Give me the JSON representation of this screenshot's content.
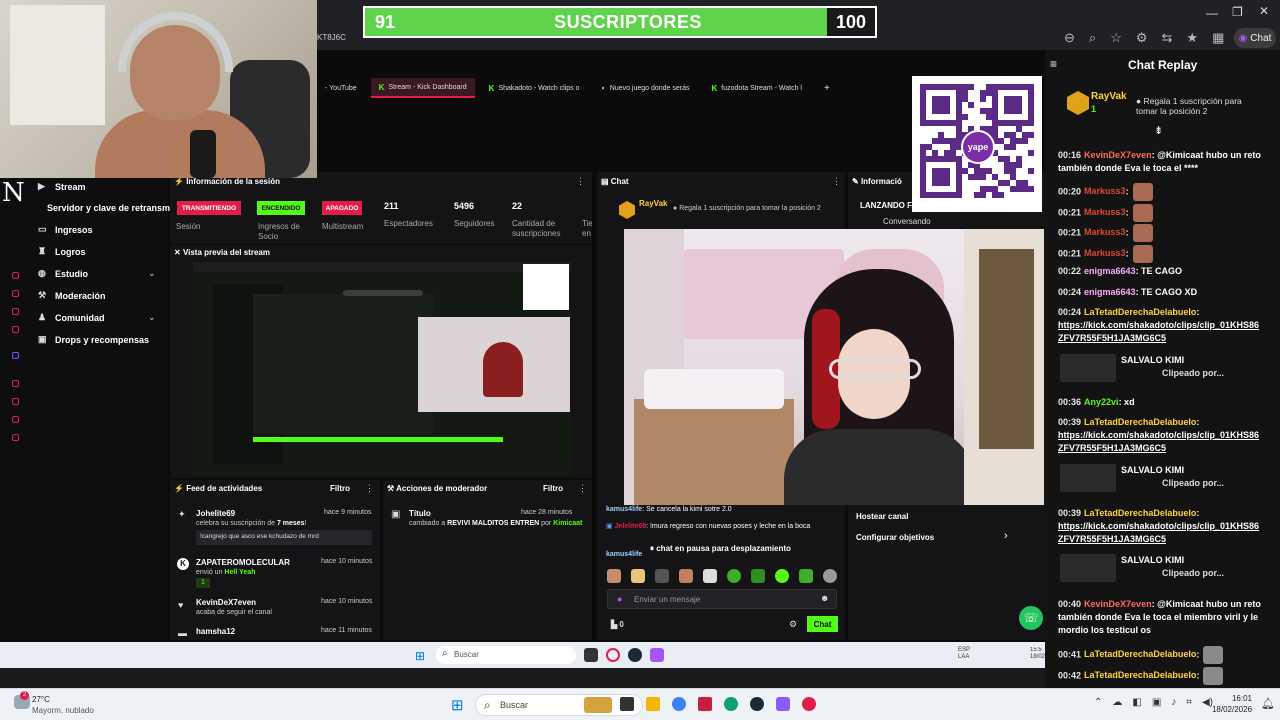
{
  "subs_bar": {
    "left": "91",
    "title": "SUSCRIPTORES",
    "right": "100"
  },
  "browser": {
    "tabs": [
      {
        "label": "- YouTube"
      },
      {
        "label": "Stream - Kick Dashboard",
        "active": true
      },
      {
        "label": "Shakadoto - Watch clips o"
      },
      {
        "label": "Nuevo juego donde serás"
      },
      {
        "label": "fuzodota Stream - Watch l"
      }
    ],
    "address_fragment": "KT8J6C",
    "chat_button": "Chat"
  },
  "kick_sidebar": {
    "logo": "N",
    "items": [
      {
        "label": "Stream",
        "icon": "stream-icon"
      },
      {
        "label": "Servidor y clave de retransm"
      },
      {
        "label": "Ingresos",
        "icon": "wallet-icon"
      },
      {
        "label": "Logros",
        "icon": "trophy-icon"
      },
      {
        "label": "Estudio",
        "icon": "palette-icon"
      },
      {
        "label": "Moderación",
        "icon": "hammer-icon"
      },
      {
        "label": "Comunidad",
        "icon": "users-icon"
      },
      {
        "label": "Drops y recompensas",
        "icon": "gift-icon"
      }
    ]
  },
  "session": {
    "title": "Información de la sesión",
    "buttons": [
      {
        "label": "TRANSMITIENDO",
        "color": "#e11d48"
      },
      {
        "label": "ENCENDIDO",
        "color": "#53fc18"
      },
      {
        "label": "APAGADO",
        "color": "#e11d48"
      }
    ],
    "sub_labels": [
      "Sesión",
      "Ingresos de Socio",
      "Multistream"
    ],
    "stats": [
      {
        "value": "211",
        "label": "Espectadores"
      },
      {
        "value": "5496",
        "label": "Seguidores"
      },
      {
        "value": "22",
        "label": "Cantidad de suscripciones"
      },
      {
        "value": "",
        "label": "Tie en"
      }
    ]
  },
  "preview": {
    "title": "Vista previa del stream"
  },
  "activity": {
    "title": "Feed de actividades",
    "filter": "Filtro",
    "items": [
      {
        "user": "Johelite69",
        "time": "hace 9 minutos",
        "text_pre": "celebra su suscripción de ",
        "text_bold": "7 meses",
        "text_post": "!",
        "message": "!cangrejo que asco ese kchudazo de mrd"
      },
      {
        "user": "ZAPATEROMOLECULAR",
        "time": "hace 10 minutos",
        "text_pre": "envió un ",
        "text_bold": "Hell Yeah",
        "text_post": "",
        "badge": "1"
      },
      {
        "user": "KevinDeX7even",
        "time": "hace 10 minutos",
        "text_pre": "acaba de seguir el canal",
        "text_bold": "",
        "text_post": ""
      },
      {
        "user": "hamsha12",
        "time": "hace 11 minutos",
        "text_pre": "",
        "text_bold": "",
        "text_post": ""
      }
    ]
  },
  "mod_actions": {
    "title": "Acciones de moderador",
    "filter": "Filtro",
    "item": {
      "label": "Título",
      "time": "hace 28 minutos",
      "text_pre": "cambiado a ",
      "text_bold": "REVIVI MALDITOS ENTREN",
      "text_by": " por ",
      "by": "Kimicaat"
    }
  },
  "chat": {
    "title": "Chat",
    "top_user": "RayVak",
    "top_text": "Regala 1 suscripción para tomar la posición 2",
    "lines": [
      {
        "user": "kamus4life",
        "text": ": Se cancela la kimi sotre 2.0"
      },
      {
        "user": "Jelelite69",
        "text": ": !mura regreso con nuevas poses y leche en la boca"
      },
      {
        "user": "kamus4life",
        "text": ""
      }
    ],
    "paused": "chat en pausa para desplazamiento",
    "input_placeholder": "Enviar un mensaje",
    "count": "0",
    "send": "Chat"
  },
  "info": {
    "title": "Informació",
    "category": "LANZANDO FA",
    "sub": "Conversando",
    "host": "Hostear canal",
    "goals": "Configurar objetivos"
  },
  "replay": {
    "title": "Chat Replay",
    "top_user": "RayVak",
    "top_count": "1",
    "top_text": "Regala 1 suscripción para tomar la posición 2",
    "messages": [
      {
        "time": "00:16",
        "user": "KevinDeX7even",
        "user_color": "#ff6a5c",
        "text": ": @Kimicaat hubo un reto también donde Eva le toca el ****"
      },
      {
        "time": "00:20",
        "user": "Markuss3",
        "user_color": "#e0452f",
        "text": ":",
        "emote": true
      },
      {
        "time": "00:21",
        "user": "Markuss3",
        "user_color": "#e0452f",
        "text": ":",
        "emote": true
      },
      {
        "time": "00:21",
        "user": "Markuss3",
        "user_color": "#e0452f",
        "text": ":",
        "emote": true
      },
      {
        "time": "00:21",
        "user": "Markuss3",
        "user_color": "#e0452f",
        "text": ":",
        "emote": true
      },
      {
        "time": "00:22",
        "user": "enigma6643",
        "user_color": "#ffaaff",
        "text": ": TE CAGO"
      },
      {
        "time": "00:24",
        "user": "enigma6643",
        "user_color": "#ffaaff",
        "text": ": TE CAGO XD"
      },
      {
        "time": "00:24",
        "user": "LaTetadDerechaDelabuelo",
        "user_color": "#ffd43b",
        "text": ":",
        "link": "https://kick.com/shakadoto/clips/clip_01KHS86ZFV7R55F5H1JA3MG6C5"
      },
      {
        "time": "00:36",
        "user": "Any22vi",
        "user_color": "#53fc18",
        "text": ": xd"
      },
      {
        "time": "00:39",
        "user": "LaTetadDerechaDelabuelo",
        "user_color": "#ffd43b",
        "text": ":",
        "link": "https://kick.com/shakadoto/clips/clip_01KHS86ZFV7R55F5H1JA3MG6C5"
      },
      {
        "time": "00:39",
        "user": "LaTetadDerechaDelabuelo",
        "user_color": "#ffd43b",
        "text": ":",
        "link": "https://kick.com/shakadoto/clips/clip_01KHS86ZFV7R55F5H1JA3MG6C5"
      },
      {
        "time": "00:40",
        "user": "KevinDeX7even",
        "user_color": "#ff6a5c",
        "text": ": @Kimicaat hubo un reto también donde Eva le toca el miembro viril y le mordio los testicul os"
      },
      {
        "time": "00:41",
        "user": "LaTetadDerechaDelabuelo",
        "user_color": "#ffd43b",
        "text": ":",
        "emote": true
      },
      {
        "time": "00:42",
        "user": "LaTetadDerechaDelabuelo",
        "user_color": "#ffd43b",
        "text": ":",
        "emote": true
      }
    ],
    "clip_title": "SALVALO KIMI",
    "clip_sub": "Clipeado por..."
  },
  "taskbar": {
    "weather_temp": "27°C",
    "weather_desc": "Mayorm. nublado",
    "search": "Buscar",
    "time": "16:01",
    "date": "18/02/2026",
    "inner_search": "Buscar",
    "inner_lang": "ESP LAA",
    "inner_time": "15:5",
    "inner_date": "18/02/2"
  },
  "colors": {
    "kick_green": "#53fc18",
    "accent_red": "#e11d48",
    "subs_green": "#5fd34c"
  }
}
